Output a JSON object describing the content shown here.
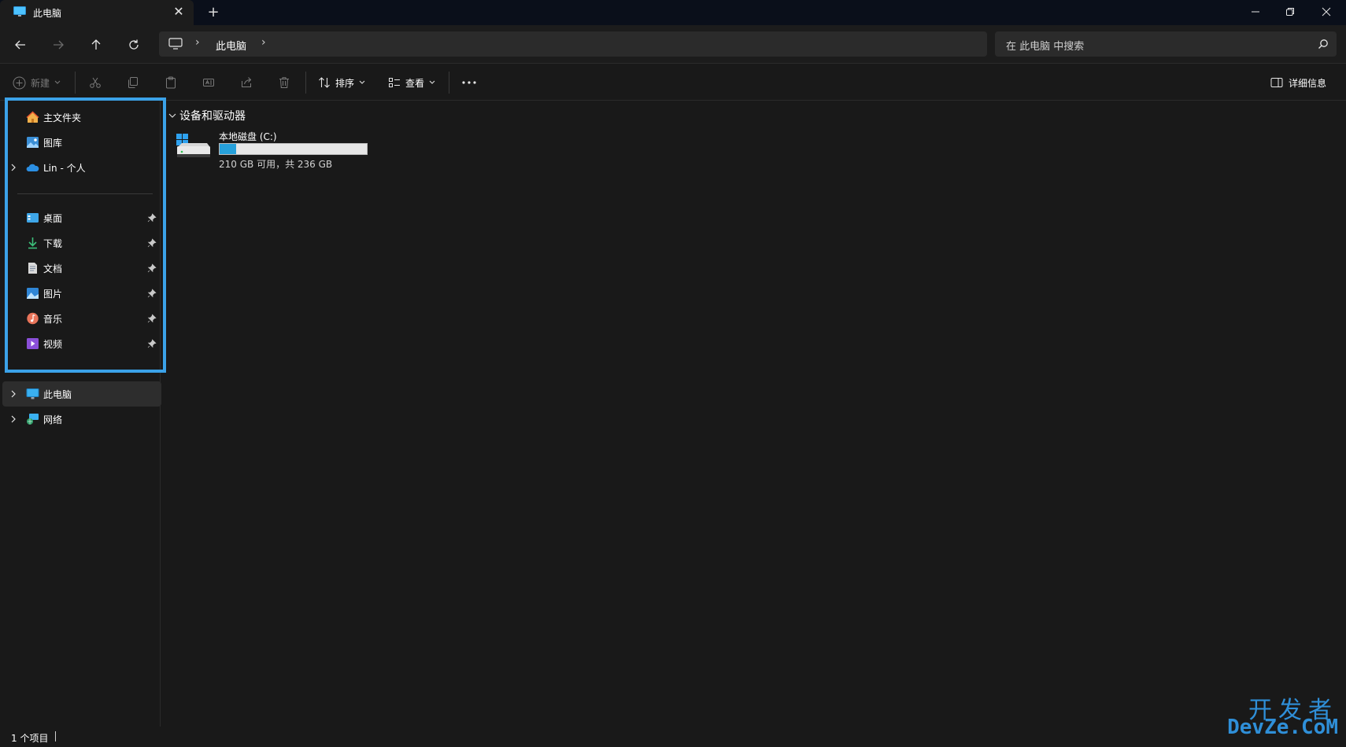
{
  "window": {
    "tab_title": "此电脑",
    "new_tab_symbol": "+",
    "close_symbol": "✕"
  },
  "address": {
    "path": [
      "此电脑"
    ]
  },
  "search": {
    "placeholder": "在 此电脑 中搜索"
  },
  "toolbar": {
    "new_label": "新建",
    "sort_label": "排序",
    "view_label": "查看",
    "details_label": "详细信息"
  },
  "sidebar": {
    "items": [
      {
        "label": "主文件夹",
        "icon": "home-icon"
      },
      {
        "label": "图库",
        "icon": "gallery-icon"
      },
      {
        "label": "Lin - 个人",
        "icon": "onedrive-icon"
      },
      {
        "label": "桌面",
        "icon": "desktop-icon",
        "pinned": true
      },
      {
        "label": "下载",
        "icon": "download-icon",
        "pinned": true
      },
      {
        "label": "文档",
        "icon": "documents-icon",
        "pinned": true
      },
      {
        "label": "图片",
        "icon": "pictures-icon",
        "pinned": true
      },
      {
        "label": "音乐",
        "icon": "music-icon",
        "pinned": true
      },
      {
        "label": "视频",
        "icon": "videos-icon",
        "pinned": true
      },
      {
        "label": "此电脑",
        "icon": "this-pc-icon",
        "selected": true
      },
      {
        "label": "网络",
        "icon": "network-icon"
      }
    ]
  },
  "content": {
    "group_title": "设备和驱动器",
    "drives": [
      {
        "name": "本地磁盘 (C:)",
        "free_text": "210 GB 可用，共 236 GB",
        "used_fraction": 0.11
      }
    ]
  },
  "status": {
    "item_count": "1 个项目"
  },
  "watermark": {
    "line1": "开发者",
    "line2": "DevZe.CoM"
  },
  "colors": {
    "accent": "#3ba2e8",
    "drive_fill": "#26a0da",
    "background": "#191919"
  }
}
